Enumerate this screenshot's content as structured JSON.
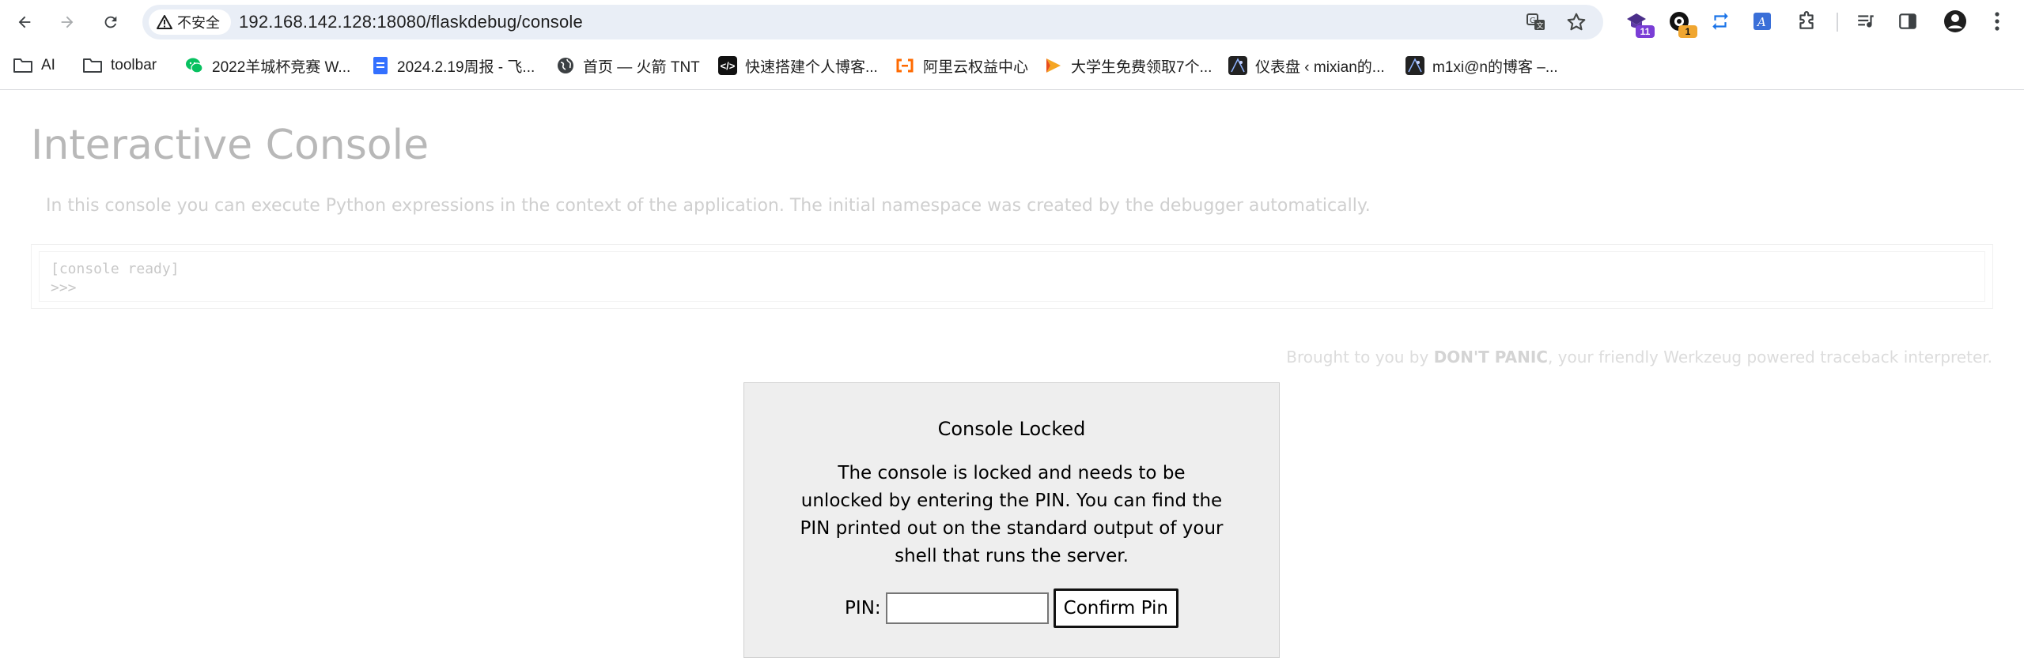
{
  "browser": {
    "security_label": "不安全",
    "url": "192.168.142.128:18080/flaskdebug/console",
    "extension_badges": {
      "ext1": "11",
      "ext2": "1"
    }
  },
  "bookmarks": [
    {
      "label": "AI",
      "icon": "folder-icon"
    },
    {
      "label": "toolbar",
      "icon": "folder-icon"
    },
    {
      "label": "2022羊城杯竞赛 W...",
      "icon": "wechat-icon",
      "color": "#07c160"
    },
    {
      "label": "2024.2.19周报 - 飞...",
      "icon": "doc-icon",
      "color": "#3370ff"
    },
    {
      "label": "首页 — 火箭 TNT",
      "icon": "globe-icon"
    },
    {
      "label": "快速搭建个人博客...",
      "icon": "code-icon",
      "color": "#111111"
    },
    {
      "label": "阿里云权益中心",
      "icon": "aliyun-icon",
      "color": "#ff6a00"
    },
    {
      "label": "大学生免费领取7个...",
      "icon": "arrow-logo-icon",
      "color": "#f5a623"
    },
    {
      "label": "仪表盘 ‹ mixian的...",
      "icon": "site-icon",
      "color": "#222222"
    },
    {
      "label": "m1xi@n的博客 –...",
      "icon": "site-icon",
      "color": "#222222"
    }
  ],
  "page": {
    "title": "Interactive Console",
    "explanation": "In this console you can execute Python expressions in the context of the application. The initial namespace was created by the debugger automatically.",
    "console_lines": [
      "[console ready]",
      ">>>"
    ],
    "footer_prefix": "Brought to you by ",
    "footer_brand": "DON'T PANIC",
    "footer_suffix": ", your friendly Werkzeug powered traceback interpreter."
  },
  "pin_dialog": {
    "title": "Console Locked",
    "message": "The console is locked and needs to be unlocked by entering the PIN. You can find the PIN printed out on the standard output of your shell that runs the server.",
    "pin_label": "PIN:",
    "pin_value": "",
    "confirm_label": "Confirm Pin"
  }
}
